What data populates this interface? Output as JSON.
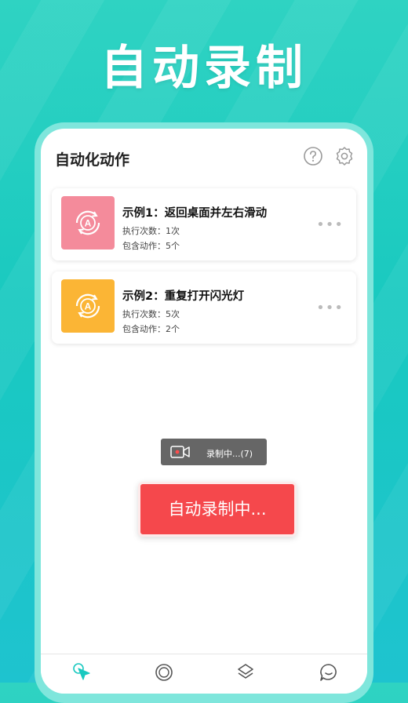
{
  "headline": "自动录制",
  "app": {
    "title": "自动化动作",
    "help_icon": "help-circle-icon",
    "settings_icon": "gear-icon"
  },
  "cards": [
    {
      "title": "示例1：返回桌面并左右滑动",
      "exec_count": "执行次数：1次",
      "actions_count": "包含动作：5个",
      "color": "#f48b9b",
      "icon": "auto-refresh-a-icon"
    },
    {
      "title": "示例2：重复打开闪光灯",
      "exec_count": "执行次数：5次",
      "actions_count": "包含动作：2个",
      "color": "#fbb535",
      "icon": "auto-refresh-a-icon"
    }
  ],
  "toast": {
    "text": "录制中...(7)",
    "icon": "video-camera-icon"
  },
  "record_button": {
    "label": "自动录制中...",
    "color": "#f5484c"
  },
  "accent": "#19c9c0",
  "bottom_nav": [
    {
      "icon": "pointer-tap-icon",
      "active": true
    },
    {
      "icon": "circle-icon",
      "active": false
    },
    {
      "icon": "layers-icon",
      "active": false
    },
    {
      "icon": "chat-bubble-icon",
      "active": false
    }
  ]
}
